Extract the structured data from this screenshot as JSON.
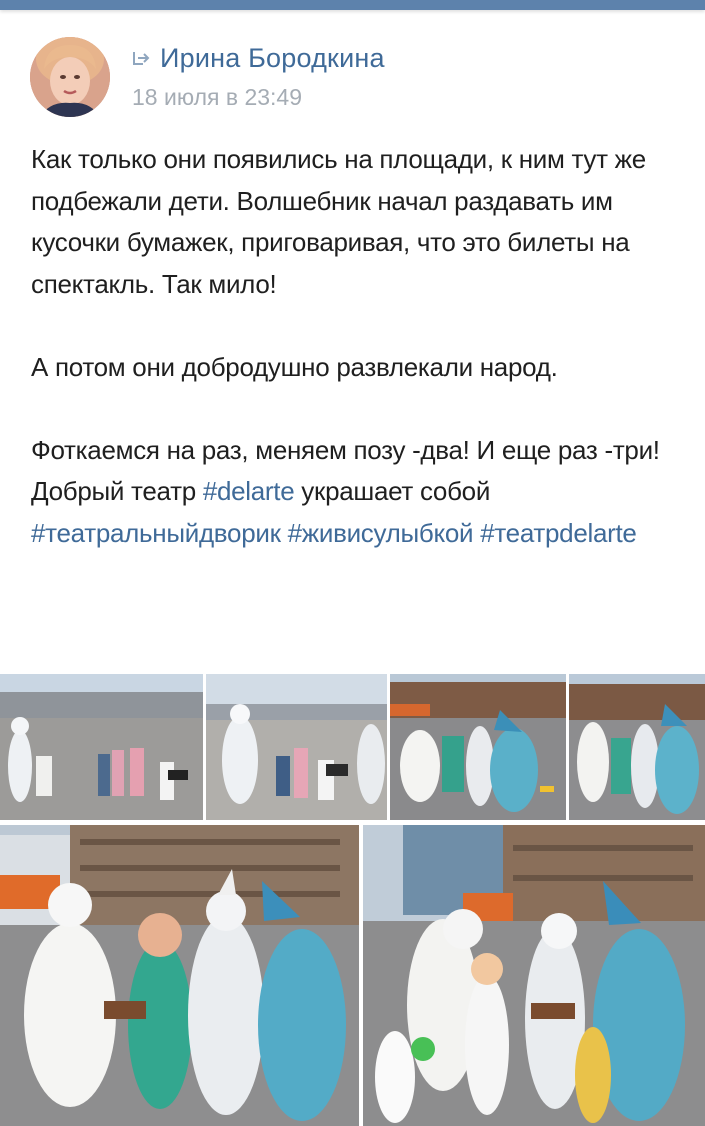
{
  "post": {
    "author": "Ирина Бородкина",
    "date": "18 июля в 23:49",
    "paragraph1": "Как только они появились на площади,  к ним тут же подбежали дети. Волшебник начал раздавать им кусочки бумажек, приговаривая,  что это билеты на спектакль. Так мило!",
    "paragraph2": "А потом они добродушно развлекали народ.",
    "paragraph3_a": "Фоткаемся на раз,  меняем позу -два!  И еще раз -три! Добрый театр ",
    "hashtag1": "#delarte",
    "paragraph3_b": " украшает собой ",
    "hashtag2": "#театральныйдворик",
    "hashtag3": "#живисулыбкой",
    "hashtag4": "#театрdelarte"
  },
  "icons": {
    "repost": "repost-arrow-icon",
    "avatar": "user-avatar"
  },
  "colors": {
    "topbar": "#5d82ac",
    "link": "#3f6a98",
    "date": "#a5acb4",
    "text": "#1f1f1f"
  },
  "photos": [
    {
      "name": "photo-1",
      "content": "children with performers on square"
    },
    {
      "name": "photo-2",
      "content": "white magician hands tickets to kids"
    },
    {
      "name": "photo-3",
      "content": "costumed troupe posing"
    },
    {
      "name": "photo-4",
      "content": "costumed troupe posing"
    },
    {
      "name": "photo-5",
      "content": "troupe posing with woman"
    },
    {
      "name": "photo-6",
      "content": "troupe posing with children"
    }
  ]
}
